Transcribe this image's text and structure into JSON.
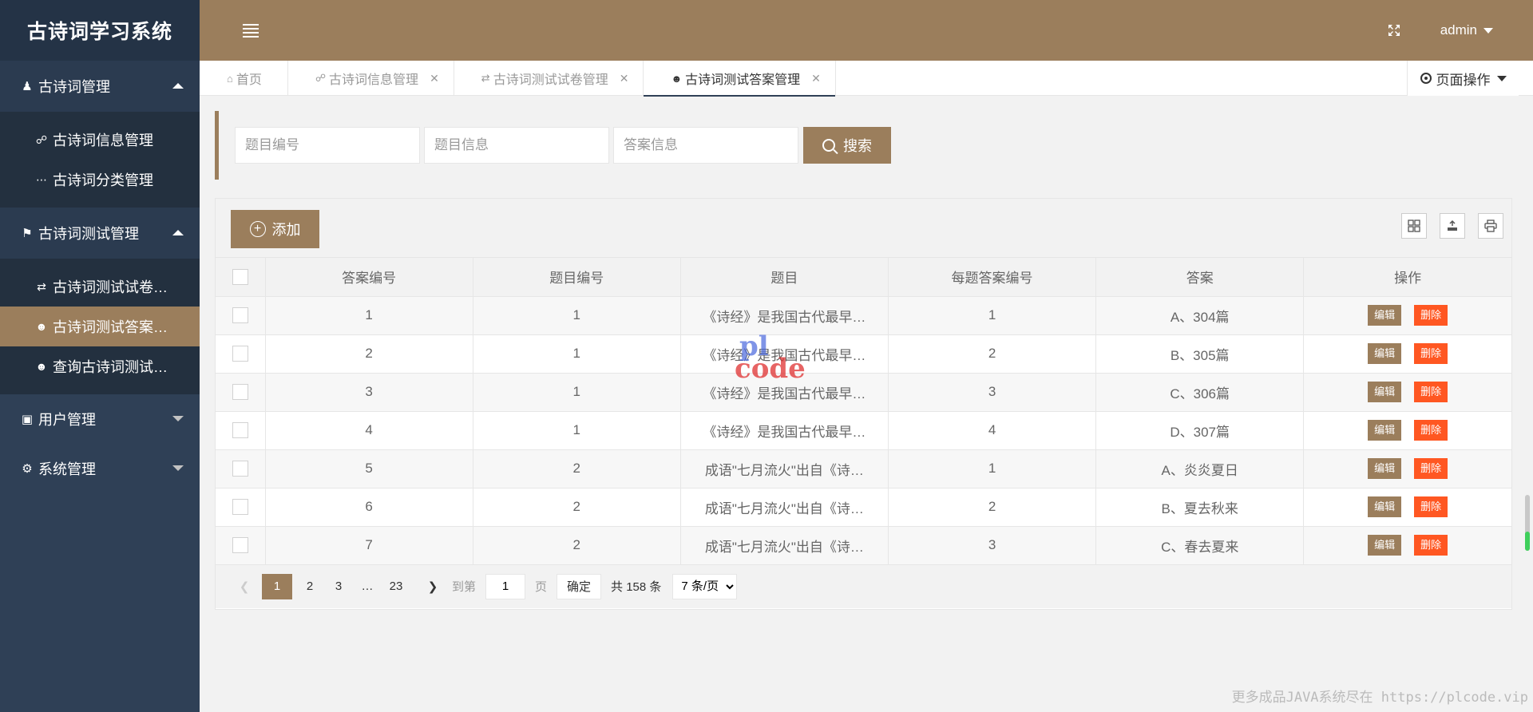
{
  "app": {
    "title": "古诗词学习系统",
    "user": "admin"
  },
  "sidebar": {
    "groups": [
      {
        "label": "古诗词管理",
        "expanded": true,
        "items": [
          {
            "label": "古诗词信息管理"
          },
          {
            "label": "古诗词分类管理"
          }
        ]
      },
      {
        "label": "古诗词测试管理",
        "expanded": true,
        "items": [
          {
            "label": "古诗词测试试卷…"
          },
          {
            "label": "古诗词测试答案…",
            "active": true
          },
          {
            "label": "查询古诗词测试…"
          }
        ]
      },
      {
        "label": "用户管理",
        "expanded": false
      },
      {
        "label": "系统管理",
        "expanded": false
      }
    ]
  },
  "tabs": [
    {
      "label": "首页"
    },
    {
      "label": "古诗词信息管理"
    },
    {
      "label": "古诗词测试试卷管理"
    },
    {
      "label": "古诗词测试答案管理",
      "active": true
    }
  ],
  "page_ops": {
    "label": "页面操作"
  },
  "search": {
    "q_id_placeholder": "题目编号",
    "q_info_placeholder": "题目信息",
    "answer_info_placeholder": "答案信息",
    "button_label": "搜索"
  },
  "toolbar": {
    "add_label": "添加"
  },
  "table": {
    "columns": [
      "答案编号",
      "题目编号",
      "题目",
      "每题答案编号",
      "答案",
      "操作"
    ],
    "edit_label": "编辑",
    "delete_label": "删除",
    "rows": [
      [
        "1",
        "1",
        "《诗经》是我国古代最早…",
        "1",
        "A、304篇"
      ],
      [
        "2",
        "1",
        "《诗经》是我国古代最早…",
        "2",
        "B、305篇"
      ],
      [
        "3",
        "1",
        "《诗经》是我国古代最早…",
        "3",
        "C、306篇"
      ],
      [
        "4",
        "1",
        "《诗经》是我国古代最早…",
        "4",
        "D、307篇"
      ],
      [
        "5",
        "2",
        "成语\"七月流火\"出自《诗…",
        "1",
        "A、炎炎夏日"
      ],
      [
        "6",
        "2",
        "成语\"七月流火\"出自《诗…",
        "2",
        "B、夏去秋来"
      ],
      [
        "7",
        "2",
        "成语\"七月流火\"出自《诗…",
        "3",
        "C、春去夏来"
      ]
    ]
  },
  "pager": {
    "pages": [
      "1",
      "2",
      "3",
      "…",
      "23"
    ],
    "goto_label": "到第",
    "goto_value": "1",
    "page_unit": "页",
    "confirm_label": "确定",
    "total_label": "共 158 条",
    "page_size_option": "7 条/页"
  },
  "watermark": {
    "line1": "pl",
    "line2": "code"
  },
  "footer_note": "更多成品JAVA系统尽在 https://plcode.vip",
  "colors": {
    "accent": "#9b7e5c",
    "sidebar": "#2f4056",
    "danger": "#ff5722"
  }
}
